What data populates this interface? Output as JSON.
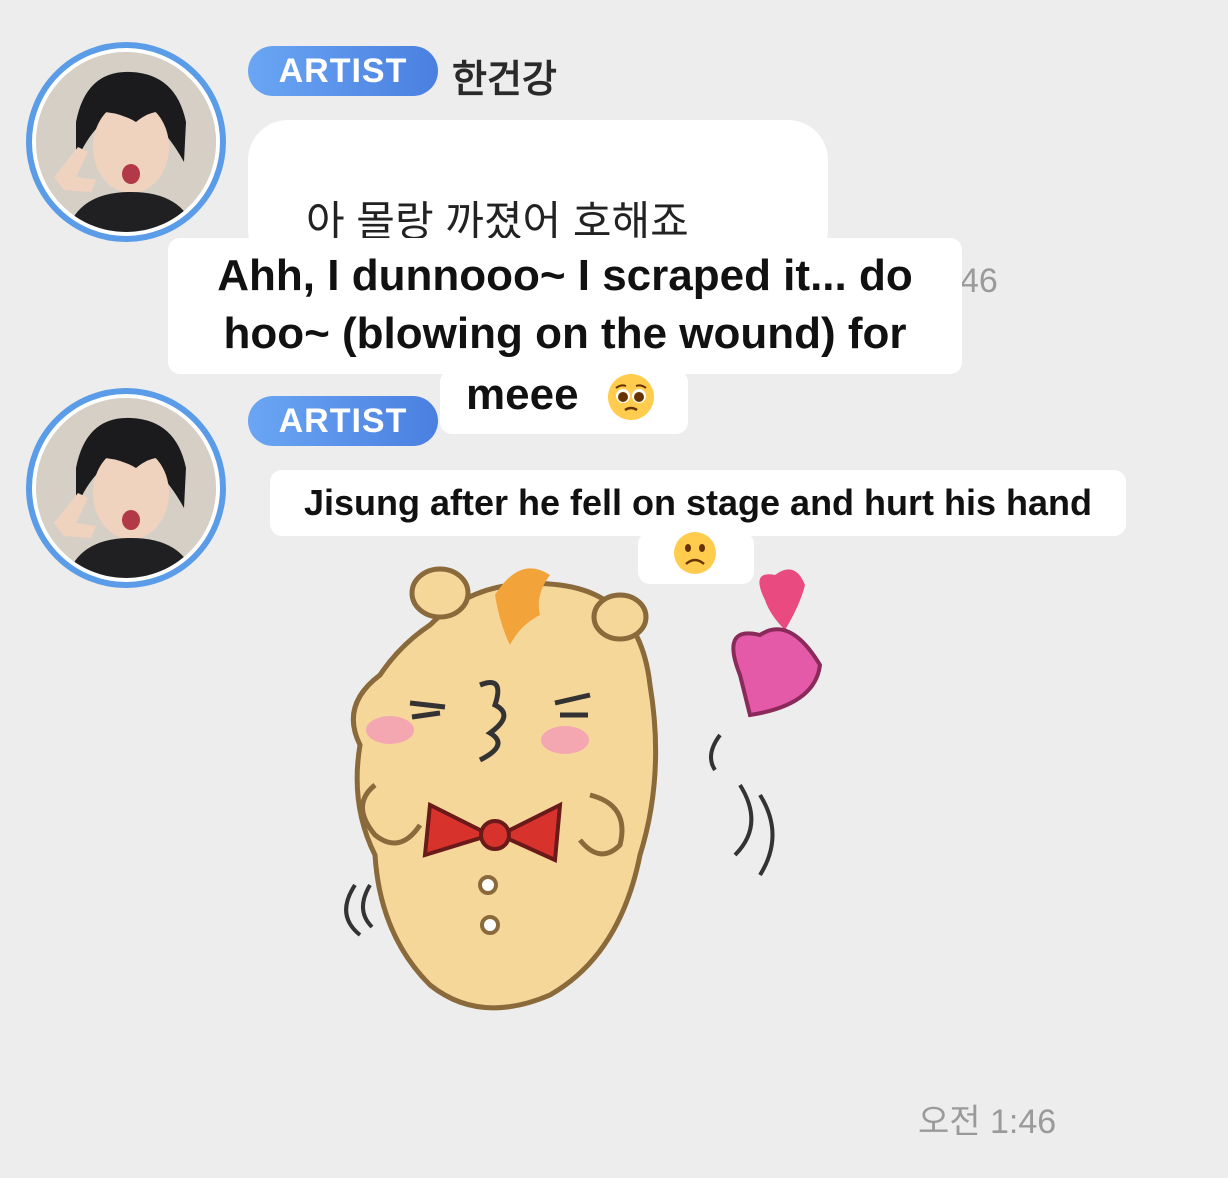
{
  "messages": [
    {
      "badge": "ARTIST",
      "sender": "한건강",
      "text": "아 몰랑 까졌어 호해죠",
      "time_partial": "46"
    },
    {
      "badge": "ARTIST",
      "sticker": "hamster-blowing-kiss-sticker",
      "time": "오전 1:46"
    }
  ],
  "captions": {
    "translation_line1": "Ahh, I dunnooo~ I scraped it... do",
    "translation_line2": "hoo~ (blowing on the wound) for",
    "translation_line3": "meee",
    "translation_emoji": "pleading-face-emoji",
    "context_line1": "Jisung after he fell on stage and hurt his hand",
    "context_emoji": "frowning-face-emoji"
  },
  "colors": {
    "background": "#ededed",
    "badge": "#5a8ee8",
    "avatar_ring": "#5a9ce8"
  }
}
